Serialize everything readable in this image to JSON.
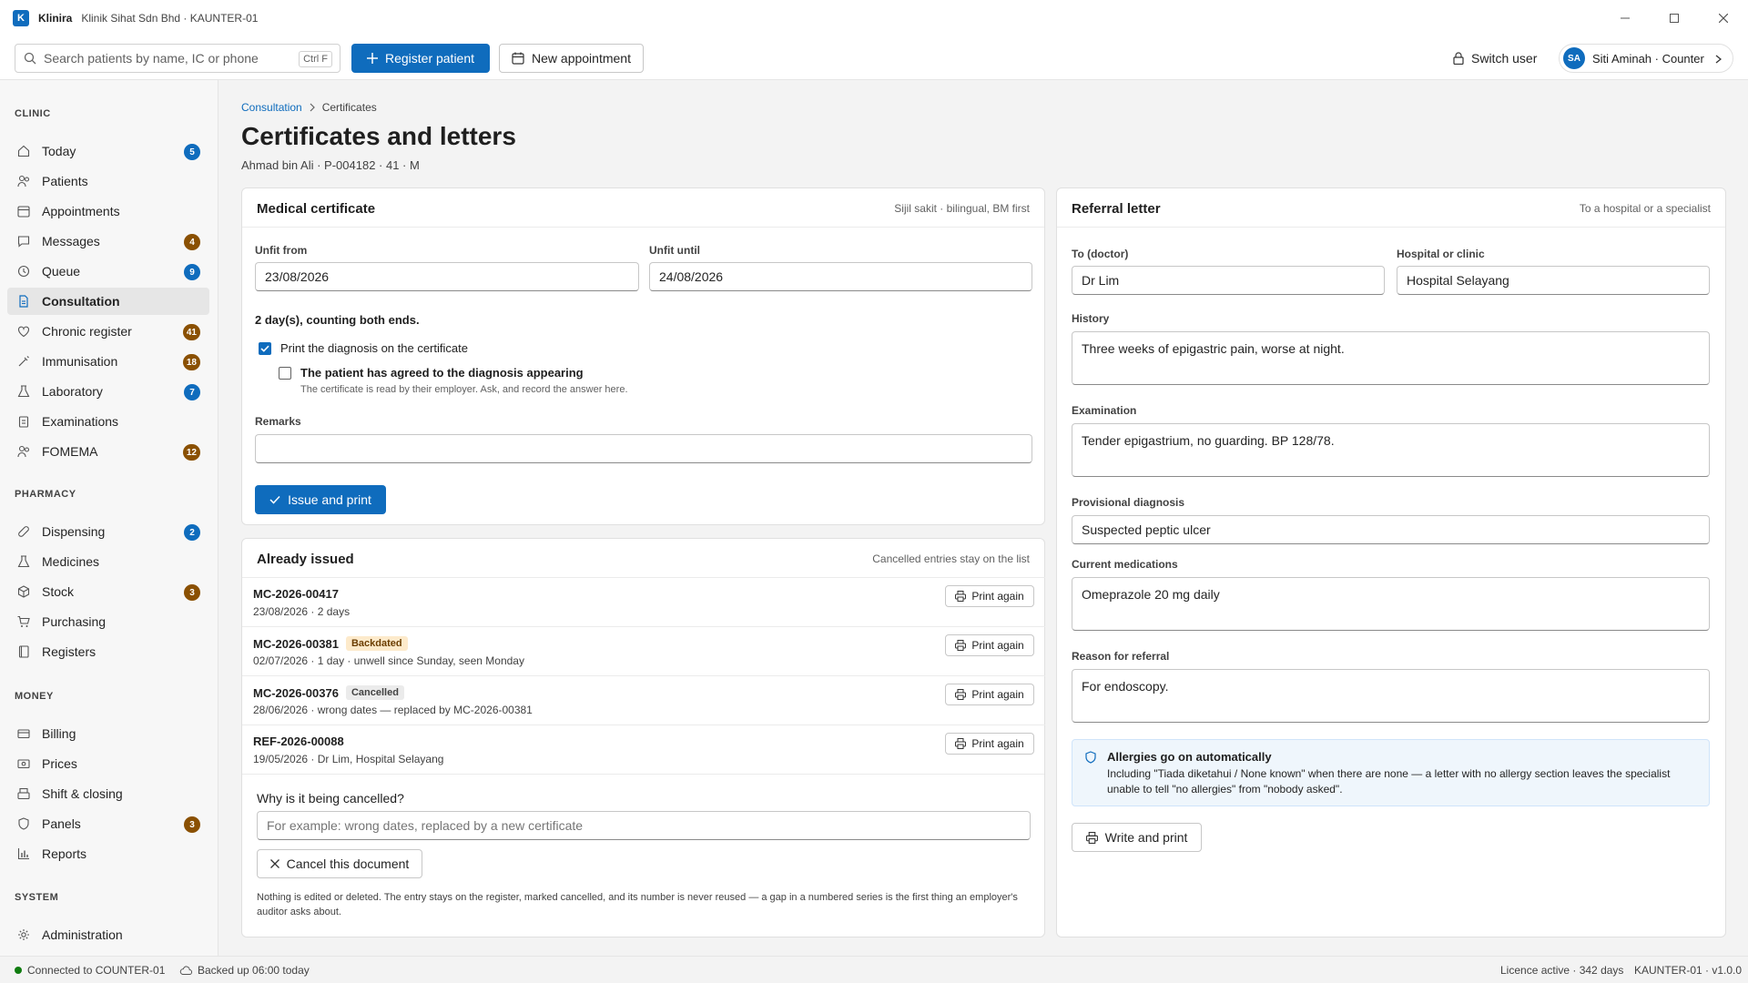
{
  "app": {
    "logo_letter": "K",
    "name": "Klinira",
    "subtitle": "Klinik Sihat Sdn Bhd · KAUNTER-01"
  },
  "toolbar": {
    "search_placeholder": "Search patients by name, IC or phone",
    "search_shortcut": "Ctrl F",
    "register_label": "Register patient",
    "appointment_label": "New appointment",
    "switch_user_label": "Switch user",
    "user_initials": "SA",
    "user_label": "Siti Aminah · Counter"
  },
  "sidebar": {
    "sections": {
      "clinic": "CLINIC",
      "pharmacy": "PHARMACY",
      "money": "MONEY",
      "system": "SYSTEM"
    },
    "items": [
      {
        "label": "Today",
        "badge": "5"
      },
      {
        "label": "Patients",
        "badge": ""
      },
      {
        "label": "Appointments",
        "badge": ""
      },
      {
        "label": "Messages",
        "badge": "4"
      },
      {
        "label": "Queue",
        "badge": "9"
      },
      {
        "label": "Consultation",
        "badge": ""
      },
      {
        "label": "Chronic register",
        "badge": "41"
      },
      {
        "label": "Immunisation",
        "badge": "18"
      },
      {
        "label": "Laboratory",
        "badge": "7"
      },
      {
        "label": "Examinations",
        "badge": ""
      },
      {
        "label": "FOMEMA",
        "badge": "12"
      },
      {
        "label": "Dispensing",
        "badge": "2"
      },
      {
        "label": "Medicines",
        "badge": ""
      },
      {
        "label": "Stock",
        "badge": "3"
      },
      {
        "label": "Purchasing",
        "badge": ""
      },
      {
        "label": "Registers",
        "badge": ""
      },
      {
        "label": "Billing",
        "badge": ""
      },
      {
        "label": "Prices",
        "badge": ""
      },
      {
        "label": "Shift & closing",
        "badge": ""
      },
      {
        "label": "Panels",
        "badge": "3"
      },
      {
        "label": "Reports",
        "badge": ""
      },
      {
        "label": "Administration",
        "badge": ""
      }
    ],
    "badge_colors": {
      "blue": "#0f6cbd",
      "orange": "#8a5002"
    }
  },
  "breadcrumb": {
    "parent": "Consultation",
    "current": "Certificates"
  },
  "page": {
    "title": "Certificates and letters",
    "patient": "Ahmad bin Ali · P-004182 · 41 · M"
  },
  "mc": {
    "title": "Medical certificate",
    "note": "Sijil sakit · bilingual, BM first",
    "from_label": "Unfit from",
    "from_value": "23/08/2026",
    "until_label": "Unfit until",
    "until_value": "24/08/2026",
    "duration": "2 day(s), counting both ends.",
    "print_diag_label": "Print the diagnosis on the certificate",
    "print_diag_checked": true,
    "consent_label": "The patient has agreed to the diagnosis appearing",
    "consent_checked": false,
    "consent_help": "The certificate is read by their employer. Ask, and record the answer here.",
    "remarks_label": "Remarks",
    "remarks_value": "",
    "issue_label": "Issue and print"
  },
  "issued": {
    "title": "Already issued",
    "note": "Cancelled entries stay on the list",
    "print_label": "Print again",
    "rows": [
      {
        "id": "MC-2026-00417",
        "tag": "",
        "meta": "23/08/2026 · 2 days"
      },
      {
        "id": "MC-2026-00381",
        "tag": "Backdated",
        "meta": "02/07/2026 · 1 day · unwell since Sunday, seen Monday"
      },
      {
        "id": "MC-2026-00376",
        "tag": "Cancelled",
        "meta": "28/06/2026 · wrong dates — replaced by MC-2026-00381"
      },
      {
        "id": "REF-2026-00088",
        "tag": "",
        "meta": "19/05/2026 · Dr Lim, Hospital Selayang"
      }
    ],
    "cancel_question": "Why is it being cancelled?",
    "cancel_placeholder": "For example: wrong dates, replaced by a new certificate",
    "cancel_button": "Cancel this document",
    "cancel_note": "Nothing is edited or deleted. The entry stays on the register, marked cancelled, and its number is never reused — a gap in a numbered series is the first thing an employer's auditor asks about."
  },
  "referral": {
    "title": "Referral letter",
    "note": "To a hospital or a specialist",
    "to_label": "To (doctor)",
    "to_value": "Dr Lim",
    "hospital_label": "Hospital or clinic",
    "hospital_value": "Hospital Selayang",
    "history_label": "History",
    "history_value": "Three weeks of epigastric pain, worse at night.",
    "exam_label": "Examination",
    "exam_value": "Tender epigastrium, no guarding. BP 128/78.",
    "diag_label": "Provisional diagnosis",
    "diag_value": "Suspected peptic ulcer",
    "meds_label": "Current medications",
    "meds_value": "Omeprazole 20 mg daily",
    "reason_label": "Reason for referral",
    "reason_value": "For endoscopy.",
    "allergy_title": "Allergies go on automatically",
    "allergy_text": "Including \"Tiada diketahui / None known\" when there are none — a letter with no allergy section leaves the specialist unable to tell \"no allergies\" from \"nobody asked\".",
    "write_label": "Write and print"
  },
  "status": {
    "connection": "Connected to COUNTER-01",
    "backup": "Backed up 06:00 today",
    "licence": "Licence active · 342 days",
    "version": "KAUNTER-01 · v1.0.0"
  },
  "colors": {
    "accent": "#0f6cbd",
    "online": "#107c10"
  }
}
